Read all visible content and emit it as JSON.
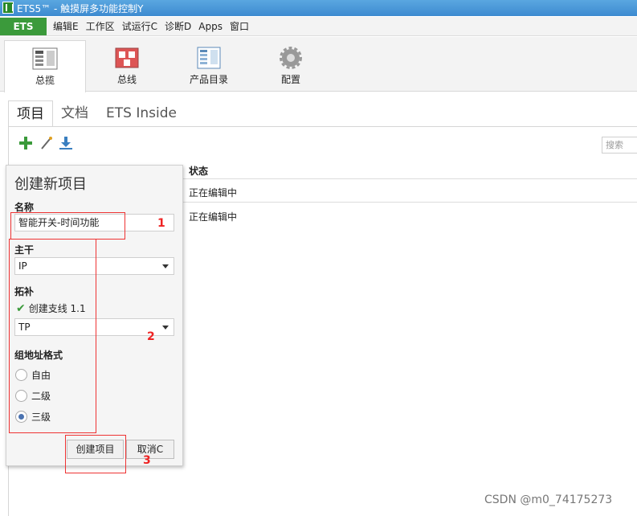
{
  "window": {
    "title": "ETS5™ - 触摸屏多功能控制Y"
  },
  "menubar": {
    "ets_button": "ETS",
    "items": [
      "编辑E",
      "工作区",
      "试运行C",
      "诊断D",
      "Apps",
      "窗口"
    ]
  },
  "ribbon": {
    "buttons": [
      {
        "label": "总揽",
        "icon": "overview-icon",
        "active": true
      },
      {
        "label": "总线",
        "icon": "bus-icon",
        "active": false
      },
      {
        "label": "产品目录",
        "icon": "catalog-icon",
        "active": false
      },
      {
        "label": "配置",
        "icon": "gear-icon",
        "active": false
      }
    ]
  },
  "tabs": [
    {
      "label": "项目",
      "active": true
    },
    {
      "label": "文档",
      "active": false
    },
    {
      "label": "ETS Inside",
      "active": false
    }
  ],
  "toolbar": {
    "search_placeholder": "搜索"
  },
  "table": {
    "status_header": "状态",
    "rows": [
      "正在编辑中",
      "正在编辑中"
    ]
  },
  "popup": {
    "title": "创建新项目",
    "name_label": "名称",
    "name_value": "智能开关-时间功能",
    "backbone_label": "主干",
    "backbone_value": "IP",
    "topology_label": "拓补",
    "create_line_label": "创建支线 1.1",
    "create_line_checked": true,
    "topology_value": "TP",
    "group_format_label": "组地址格式",
    "group_formats": [
      {
        "label": "自由",
        "selected": false
      },
      {
        "label": "二级",
        "selected": false
      },
      {
        "label": "三级",
        "selected": true
      }
    ],
    "create_button": "创建项目",
    "cancel_button": "取消C"
  },
  "annotations": [
    "1",
    "2",
    "3"
  ],
  "watermark": "CSDN @m0_74175273"
}
